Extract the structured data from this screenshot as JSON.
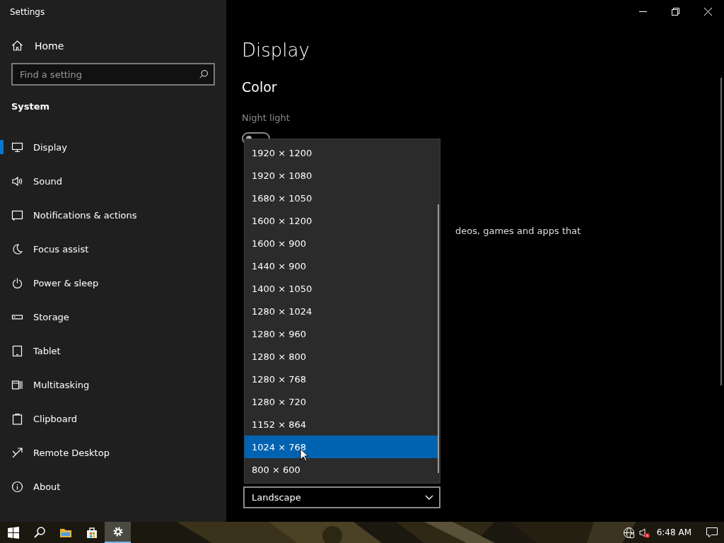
{
  "window": {
    "title": "Settings",
    "controls": [
      {
        "kind": "minimize"
      },
      {
        "kind": "restore"
      },
      {
        "kind": "close"
      }
    ]
  },
  "sidebar": {
    "home": "Home",
    "search": {
      "placeholder": "Find a setting"
    },
    "section": "System",
    "items": [
      {
        "label": "Display",
        "selected": true
      },
      {
        "label": "Sound",
        "selected": false
      },
      {
        "label": "Notifications & actions",
        "selected": false
      },
      {
        "label": "Focus assist",
        "selected": false
      },
      {
        "label": "Power & sleep",
        "selected": false
      },
      {
        "label": "Storage",
        "selected": false
      },
      {
        "label": "Tablet",
        "selected": false
      },
      {
        "label": "Multitasking",
        "selected": false
      },
      {
        "label": "Clipboard",
        "selected": false
      },
      {
        "label": "Remote Desktop",
        "selected": false
      },
      {
        "label": "About",
        "selected": false
      }
    ]
  },
  "main": {
    "title": "Display",
    "section": "Color",
    "night_light": {
      "label": "Night light",
      "on": false
    },
    "description_fragment": "deos, games and apps that",
    "orientation": {
      "value": "Landscape"
    },
    "resolution_list": {
      "items": [
        {
          "label": "1920 × 1200",
          "selected": false
        },
        {
          "label": "1920 × 1080",
          "selected": false
        },
        {
          "label": "1680 × 1050",
          "selected": false
        },
        {
          "label": "1600 × 1200",
          "selected": false
        },
        {
          "label": "1600 × 900",
          "selected": false
        },
        {
          "label": "1440 × 900",
          "selected": false
        },
        {
          "label": "1400 × 1050",
          "selected": false
        },
        {
          "label": "1280 × 1024",
          "selected": false
        },
        {
          "label": "1280 × 960",
          "selected": false
        },
        {
          "label": "1280 × 800",
          "selected": false
        },
        {
          "label": "1280 × 768",
          "selected": false
        },
        {
          "label": "1280 × 720",
          "selected": false
        },
        {
          "label": "1152 × 864",
          "selected": false
        },
        {
          "label": "1024 × 768",
          "selected": true
        },
        {
          "label": "800 × 600",
          "selected": false
        }
      ]
    }
  },
  "taskbar": {
    "apps": [
      {
        "kind": "start",
        "active": false
      },
      {
        "kind": "search",
        "active": false
      },
      {
        "kind": "explorer",
        "active": false
      },
      {
        "kind": "store",
        "active": false
      },
      {
        "kind": "settings",
        "active": true
      }
    ],
    "tray": [
      {
        "kind": "network"
      },
      {
        "kind": "volume-muted"
      }
    ],
    "time": "6:48 AM"
  }
}
